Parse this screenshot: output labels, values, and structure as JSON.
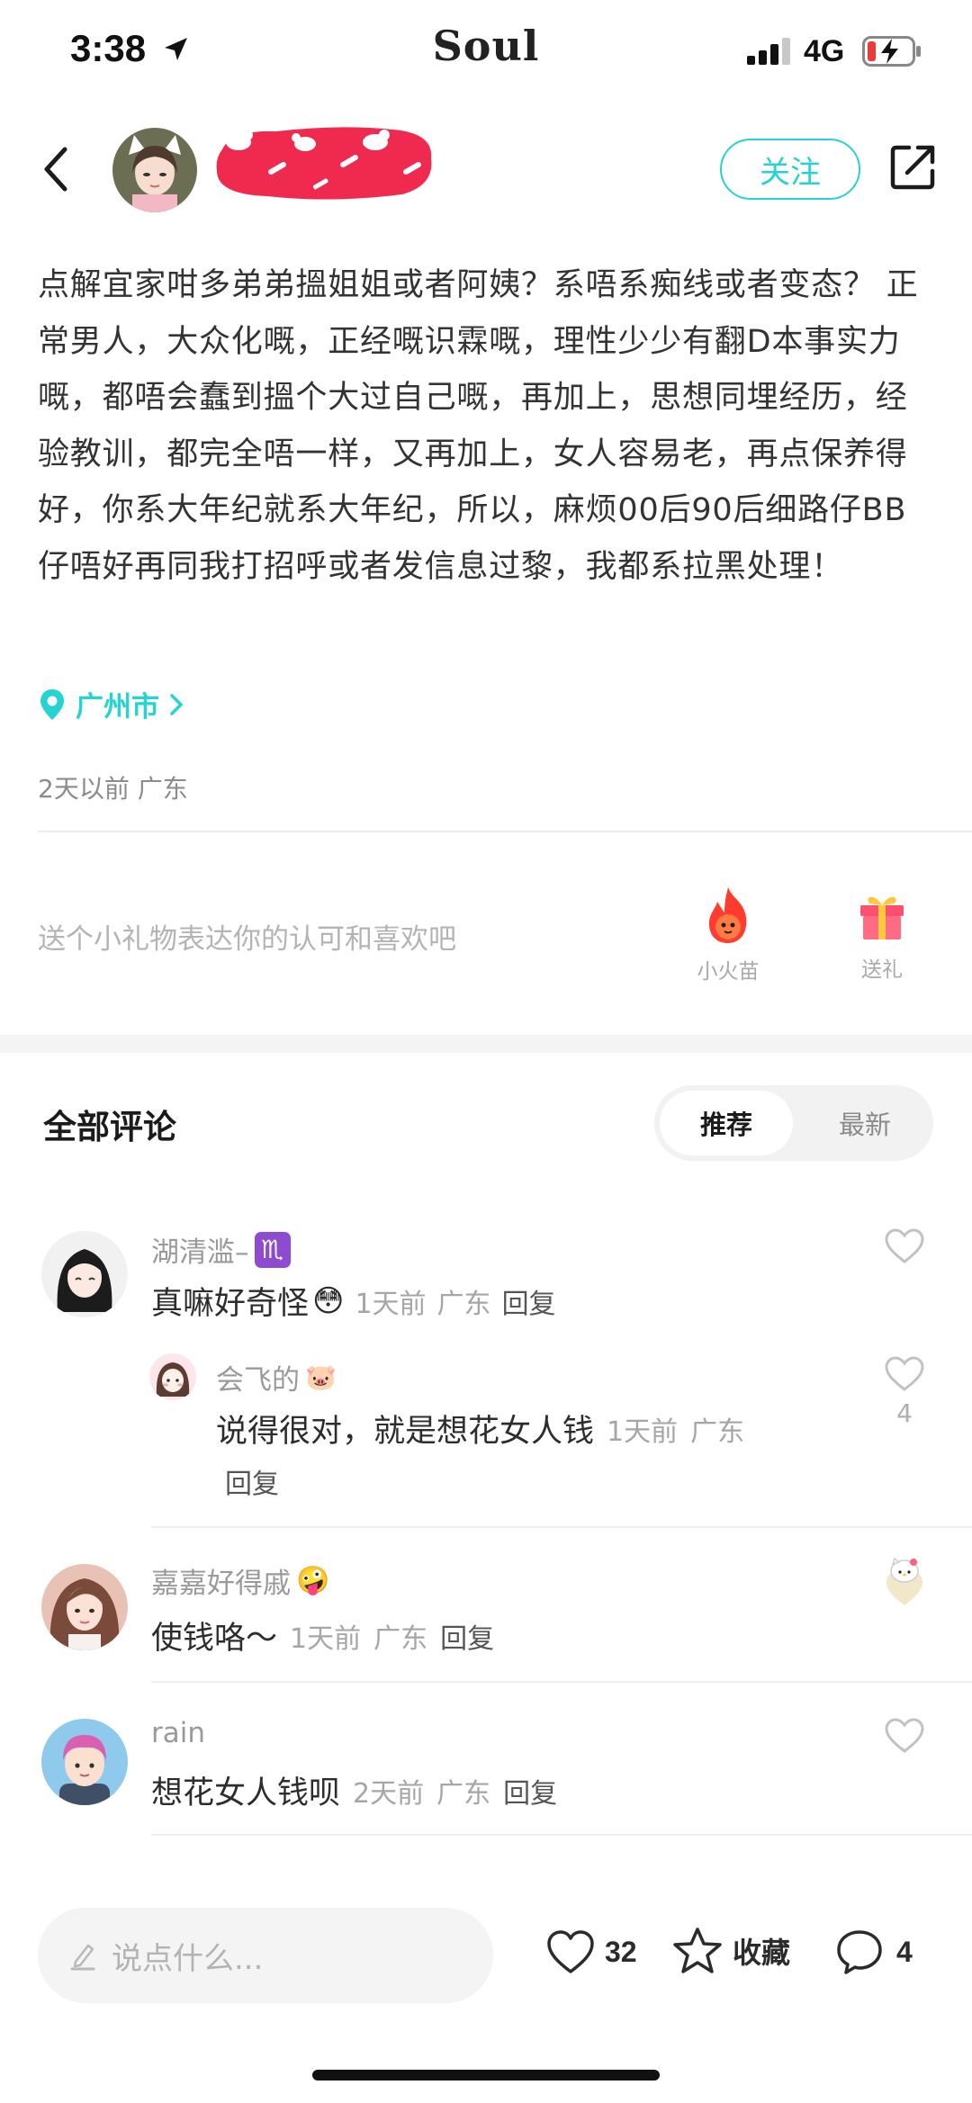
{
  "status_bar": {
    "time": "3:38",
    "app": "Soul",
    "network": "4G"
  },
  "header": {
    "follow_label": "关注"
  },
  "post": {
    "text": "点解宜家咁多弟弟搵姐姐或者阿姨？系唔系痴线或者变态？ 正常男人，大众化嘅，正经嘅识霖嘅，理性少少有翻D本事实力嘅，都唔会蠢到搵个大过自己嘅，再加上，思想同埋经历，经验教训，都完全唔一样，又再加上，女人容易老，再点保养得好，你系大年纪就系大年纪，所以，麻烦00后90后细路仔BB仔唔好再同我打招呼或者发信息过黎，我都系拉黑处理！",
    "location": "广州市",
    "meta": "2天以前 广东"
  },
  "gift": {
    "prompt": "送个小礼物表达你的认可和喜欢吧",
    "fire_label": "小火苗",
    "gift_label": "送礼"
  },
  "comments_section": {
    "title": "全部评论",
    "sort_recommended": "推荐",
    "sort_latest": "最新",
    "comments": [
      {
        "username": "湖清滥–",
        "username_emoji": "♏",
        "text": "真嘛好奇怪",
        "text_emoji": "😳",
        "time": "1天前",
        "region": "广东",
        "reply": "回复"
      },
      {
        "username": "会飞的",
        "username_emoji": "🐷",
        "text": "说得很对，就是想花女人钱",
        "time": "1天前",
        "region": "广东",
        "reply": "回复",
        "likes": "4"
      },
      {
        "username": "嘉嘉好得戚",
        "username_emoji": "🤪",
        "text": "使钱咯～",
        "time": "1天前",
        "region": "广东",
        "reply": "回复"
      },
      {
        "username": "rain",
        "text": "想花女人钱呗",
        "time": "2天前",
        "region": "广东",
        "reply": "回复"
      }
    ]
  },
  "bottom_bar": {
    "placeholder": "说点什么...",
    "likes": "32",
    "favorite_label": "收藏",
    "comments": "4"
  },
  "colors": {
    "accent": "#25d4d0",
    "redaction": "#f0294f"
  }
}
